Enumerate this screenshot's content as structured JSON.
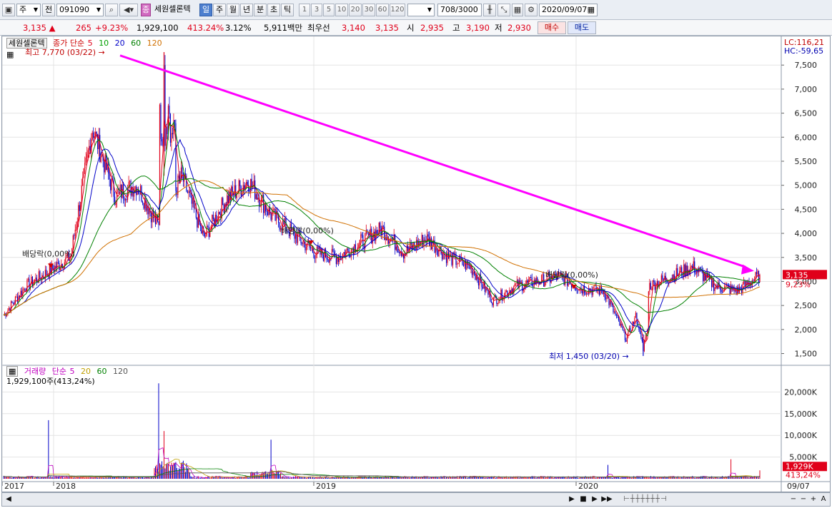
{
  "toolbar": {
    "type_label": "주",
    "prev_label": "전",
    "stock_code": "091090",
    "stock_name": "세원셀론텍",
    "badge_label": "종",
    "periods": [
      "일",
      "주",
      "월",
      "년",
      "분",
      "초",
      "틱"
    ],
    "active_period": "일",
    "intervals": [
      "1",
      "3",
      "5",
      "10",
      "20",
      "30",
      "60",
      "120"
    ],
    "count_value": "708",
    "count_total": "/3000",
    "date_value": "2020/09/07"
  },
  "quote": {
    "price": "3,135",
    "change_arrow": "▲",
    "change": "265",
    "change_pct": "+9.23%",
    "volume": "1,929,100",
    "volume_ratio": "413.24%",
    "turnover": "3.12%",
    "amount": "5,911백만",
    "best_ask_label": "최우선",
    "best_ask": "3,140",
    "best_bid": "3,135",
    "open_label": "시",
    "open": "2,935",
    "high_label": "고",
    "high": "3,190",
    "low_label": "저",
    "low": "2,930",
    "buy_label": "매수",
    "sell_label": "매도"
  },
  "price_panel": {
    "name": "세원셀론텍",
    "legend_label": "종가 단순",
    "ma_periods": [
      "5",
      "10",
      "20",
      "60",
      "120"
    ],
    "lc": "LC:116,21",
    "hc": "HC:-59,65",
    "high_annotation": "최고 7,770 (03/22)",
    "low_annotation": "최저 1,450 (03/20)",
    "dividend_annotations": [
      "배당락(0,00%)",
      "배당락(0,00%)",
      "배당락(0,00%)"
    ],
    "current_price_tag": "3,135",
    "current_pct_tag": "9,23%",
    "y_ticks": [
      "7,500",
      "7,000",
      "6,500",
      "6,000",
      "5,500",
      "5,000",
      "4,500",
      "4,000",
      "3,500",
      "3,000",
      "2,500",
      "2,000",
      "1,500"
    ]
  },
  "volume_panel": {
    "legend_label": "거래량",
    "ma_label": "단순",
    "ma_periods": [
      "5",
      "20",
      "60",
      "120"
    ],
    "volume_text": "1,929,100주(413,24%)",
    "y_ticks": [
      "20,000K",
      "15,000K",
      "10,000K",
      "5,000K"
    ],
    "current_tag": "1,929K",
    "current_pct": "413,24%"
  },
  "x_axis": {
    "labels": [
      "2017",
      "2018",
      "2019",
      "2020"
    ],
    "last_label": "09/07"
  },
  "colors": {
    "up": "#e0001a",
    "down": "#0000c8",
    "ma5": "#e0001a",
    "ma10": "#008000",
    "ma20": "#0000c8",
    "ma60": "#008000",
    "ma120": "#d07000",
    "trendline": "#ff00ff",
    "grid": "#e4e4e4"
  },
  "chart_data": {
    "type": "line",
    "title": "세원셀론텍",
    "series": [
      {
        "name": "종가",
        "x": [
          "2017-11",
          "2017-12",
          "2018-01",
          "2018-02",
          "2018-03",
          "2018-04",
          "2018-05",
          "2018-06",
          "2018-07",
          "2018-08",
          "2018-09",
          "2018-10",
          "2018-11",
          "2018-12",
          "2019-01",
          "2019-02",
          "2019-03",
          "2019-04",
          "2019-05",
          "2019-06",
          "2019-07",
          "2019-08",
          "2019-09",
          "2019-10",
          "2019-11",
          "2019-12",
          "2020-01",
          "2020-02",
          "2020-03",
          "2020-04",
          "2020-05",
          "2020-06",
          "2020-07",
          "2020-08",
          "2020-09"
        ],
        "values": [
          2300,
          2900,
          3200,
          3500,
          6200,
          4800,
          5000,
          4100,
          5200,
          3900,
          4700,
          5100,
          4400,
          4000,
          3600,
          3500,
          3800,
          4100,
          3600,
          3900,
          3500,
          3300,
          2600,
          2900,
          3000,
          3100,
          2850,
          2800,
          1800,
          2900,
          3100,
          3300,
          2900,
          2800,
          3135
        ]
      }
    ],
    "ylim": [
      1300,
      7800
    ],
    "annotations": [
      "최고 7,770 (03/22)",
      "최저 1,450 (03/20)"
    ]
  }
}
